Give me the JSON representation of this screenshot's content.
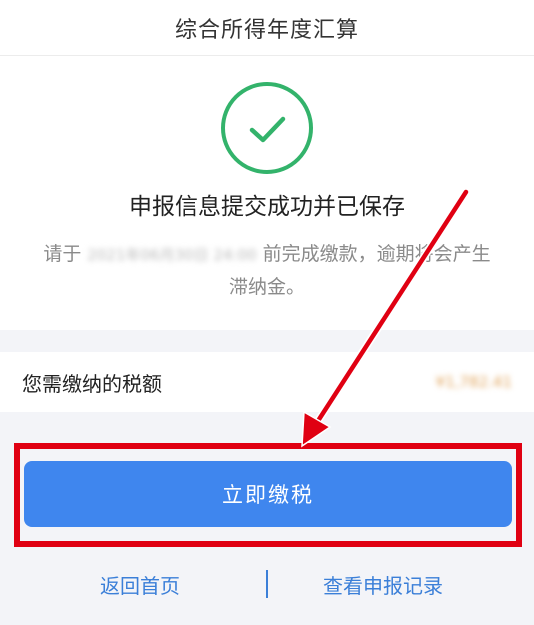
{
  "header": {
    "title": "综合所得年度汇算"
  },
  "status": {
    "icon": "check-circle-icon",
    "message": "申报信息提交成功并已保存"
  },
  "deadline": {
    "prefix": "请于",
    "date": "2021年06月30日 24:00",
    "suffix": "前完成缴款，逾期将会产生滞纳金。"
  },
  "tax": {
    "label": "您需缴纳的税额",
    "amount": "¥1,782.41"
  },
  "actions": {
    "pay_label": "立即缴税",
    "home_label": "返回首页",
    "records_label": "查看申报记录"
  },
  "annotation": {
    "arrow_color": "#e00012",
    "highlight_color": "#e00012"
  },
  "colors": {
    "primary_button": "#3f86ee",
    "link": "#3b7fd8",
    "success": "#33b36b"
  }
}
